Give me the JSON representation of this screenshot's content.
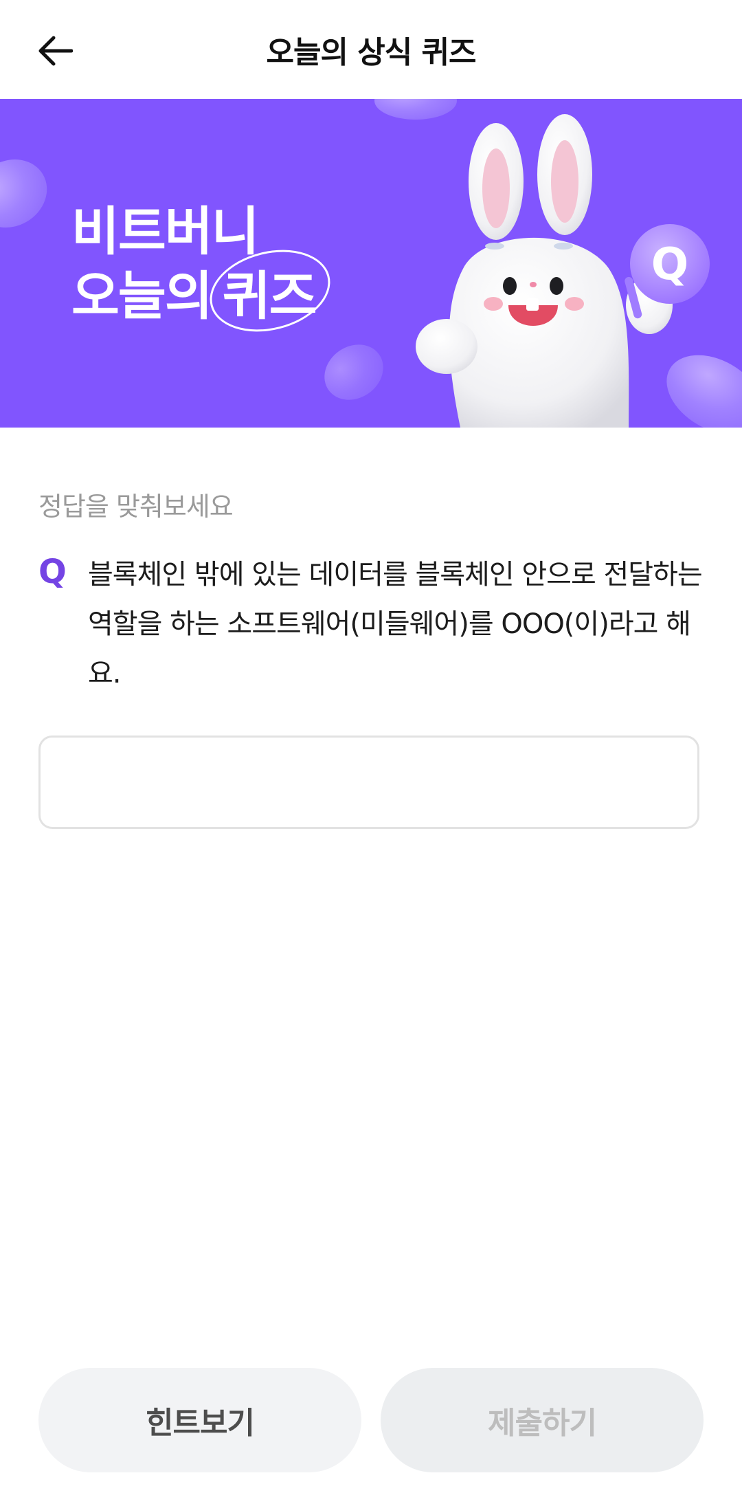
{
  "header": {
    "title": "오늘의 상식 퀴즈",
    "back_icon": "arrow-left-icon"
  },
  "banner": {
    "title_line1": "비트버니",
    "title_line2_prefix": "오늘의",
    "title_line2_circled": "퀴즈",
    "mascot_badge": "Q",
    "background_color": "#8155fe"
  },
  "quiz": {
    "instruction": "정답을 맞춰보세요",
    "q_mark": "Q",
    "question": "블록체인 밖에 있는 데이터를 블록체인 안으로 전달하는 역할을 하는 소프트웨어(미들웨어)를 OOO(이)라고 해요.",
    "answer_value": "",
    "answer_placeholder": ""
  },
  "buttons": {
    "hint_label": "힌트보기",
    "submit_label": "제출하기"
  },
  "colors": {
    "accent": "#7444e4",
    "disabled_text": "#bdbdbd"
  }
}
